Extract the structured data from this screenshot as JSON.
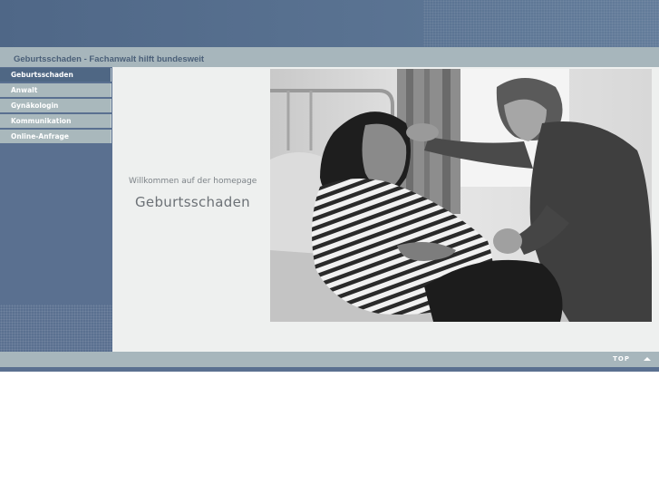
{
  "site": {
    "title": "Geburtsschaden - Fachanwalt hilft bundesweit"
  },
  "nav": {
    "items": [
      {
        "label": "Geburtsschaden",
        "active": true
      },
      {
        "label": "Anwalt",
        "active": false
      },
      {
        "label": "Gynäkologin",
        "active": false
      },
      {
        "label": "Kommunikation",
        "active": false
      },
      {
        "label": "Online-Anfrage",
        "active": false
      }
    ]
  },
  "main": {
    "welcome": "Willkommen auf der homepage",
    "heading": "Geburtsschaden",
    "photo_icon": "photo-pregnant-woman-in-hospital-bed"
  },
  "footer": {
    "top_label": "TOP",
    "top_icon": "chevron-up-icon"
  },
  "colors": {
    "header": "#58708f",
    "bar": "#a7b6bc",
    "nav_active": "#4f6784",
    "content_bg": "#eef0ef"
  }
}
